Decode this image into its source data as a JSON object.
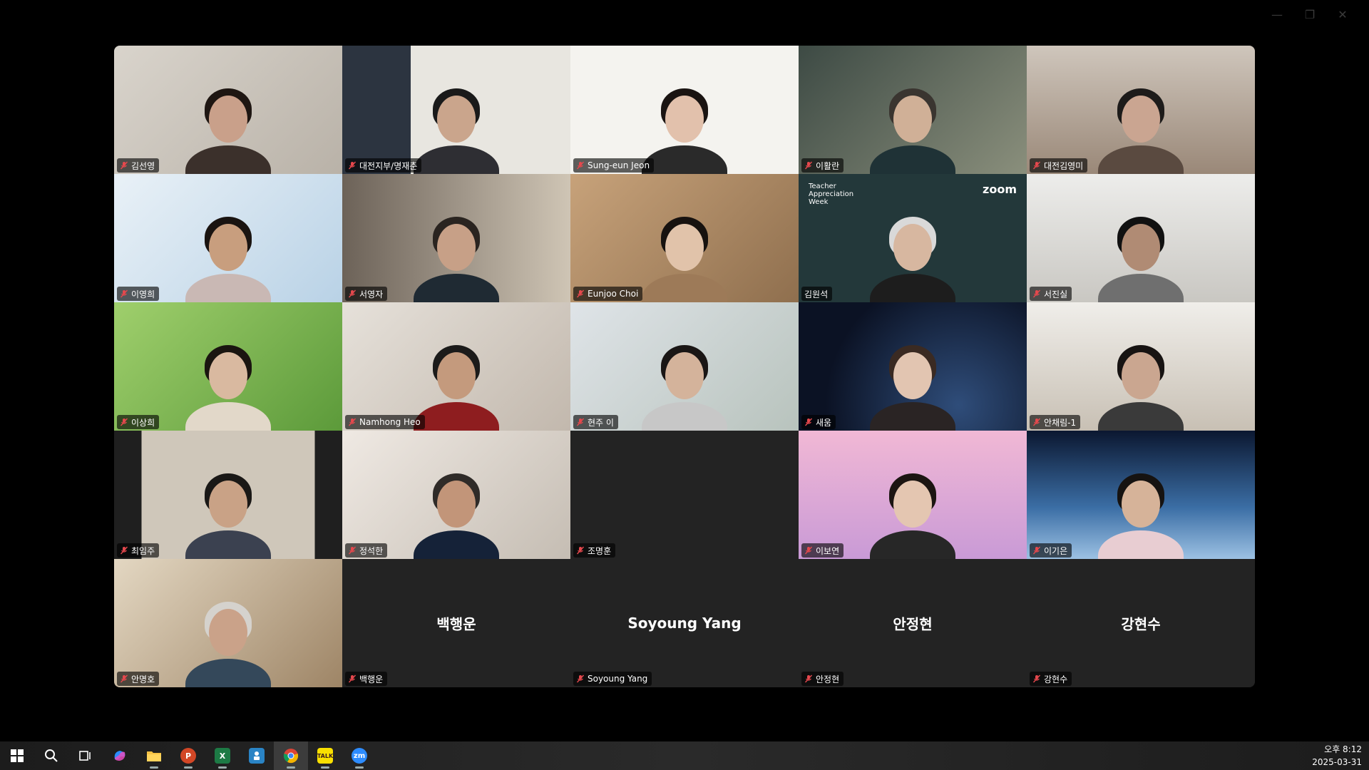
{
  "participants": [
    {
      "name": "김선영",
      "muted": true
    },
    {
      "name": "대전지부/명재춘",
      "muted": true
    },
    {
      "name": "Sung-eun Jeon",
      "muted": true
    },
    {
      "name": "이활란",
      "muted": true
    },
    {
      "name": "대전김영미",
      "muted": true
    },
    {
      "name": "이영희",
      "muted": true
    },
    {
      "name": "서영자",
      "muted": true
    },
    {
      "name": "Eunjoo Choi",
      "muted": true
    },
    {
      "name": "김원석",
      "muted": false,
      "active_speaker": true,
      "background_text": "Teacher Appreciation Week",
      "background_logo": "zoom"
    },
    {
      "name": "서진실",
      "muted": true
    },
    {
      "name": "이상희",
      "muted": true
    },
    {
      "name": "Namhong Heo",
      "muted": true
    },
    {
      "name": "현주 이",
      "muted": true
    },
    {
      "name": "새움",
      "muted": true
    },
    {
      "name": "안채림-1",
      "muted": true
    },
    {
      "name": "최임주",
      "muted": true
    },
    {
      "name": "정석한",
      "muted": true
    },
    {
      "name": "조명훈",
      "muted": true
    },
    {
      "name": "이보연",
      "muted": true
    },
    {
      "name": "이기은",
      "muted": true
    },
    {
      "name": "안명호",
      "muted": true
    },
    {
      "name": "백행운",
      "muted": true,
      "video_off": true
    },
    {
      "name": "Soyoung Yang",
      "muted": true,
      "video_off": true
    },
    {
      "name": "안정현",
      "muted": true,
      "video_off": true
    },
    {
      "name": "강현수",
      "muted": true,
      "video_off": true
    }
  ],
  "taskbar": {
    "apps": [
      "windows-start-icon",
      "search-icon",
      "task-view-icon",
      "copilot-icon",
      "file-explorer-icon",
      "powerpoint-icon",
      "excel-icon",
      "app-icon",
      "chrome-icon",
      "kakaotalk-icon",
      "zoom-icon"
    ],
    "excel_letter": "X",
    "powerpoint_letter": "P",
    "kakaotalk_label": "TALK",
    "zoom_label": "zm",
    "time": "오후 8:12",
    "date": "2025-03-31"
  },
  "colors": {
    "active_speaker_border": "#4ade80",
    "mute_icon": "#e5484d"
  }
}
